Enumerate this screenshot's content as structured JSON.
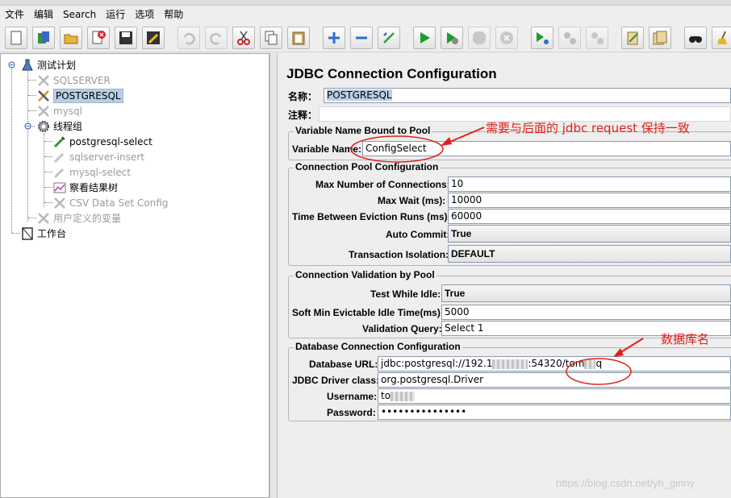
{
  "menu": [
    "文件",
    "编辑",
    "Search",
    "运行",
    "选项",
    "帮助"
  ],
  "toolbar": {
    "icons": [
      "new-icon",
      "templates-icon",
      "open-icon",
      "close-icon",
      "save-icon",
      "save-as-icon",
      "undo-icon",
      "redo-icon",
      "cut-icon",
      "copy-icon",
      "paste-icon",
      "expand-icon",
      "collapse-icon",
      "toggle-icon",
      "start-icon",
      "start-no-pauses-icon",
      "stop-icon",
      "shutdown-icon",
      "remote-start-icon",
      "remote-stop-icon",
      "remote-shutdown-icon",
      "clear-icon",
      "clear-all-icon",
      "search-icon",
      "reset-search-icon"
    ]
  },
  "tree": {
    "test_plan": "测试计划",
    "sqlserver": "SQLSERVER",
    "postgresql": "POSTGRESQL",
    "mysql": "mysql",
    "thread_group": "线程组",
    "postgresql_select": "postgresql-select",
    "sqlserver_insert": "sqlserver-insert",
    "mysql_select": "mysql-select",
    "result_tree": "察看结果树",
    "csv_config": "CSV Data Set Config",
    "user_vars": "用户定义的变量",
    "workbench": "工作台"
  },
  "config": {
    "title": "JDBC Connection Configuration",
    "name_label": "名称：",
    "name_value": "POSTGRESQL",
    "comment_label": "注释：",
    "comment_value": "",
    "pool_group": {
      "title": "Variable Name Bound to Pool",
      "variable_label": "Variable Name:",
      "variable_value": "ConfigSelect"
    },
    "connection_pool": {
      "title": "Connection Pool Configuration",
      "max_conn_label": "Max Number of Connections:",
      "max_conn_value": "10",
      "max_wait_label": "Max Wait (ms):",
      "max_wait_value": "10000",
      "eviction_label": "Time Between Eviction Runs (ms):",
      "eviction_value": "60000",
      "auto_commit_label": "Auto Commit:",
      "auto_commit_value": "True",
      "isolation_label": "Transaction Isolation:",
      "isolation_value": "DEFAULT"
    },
    "validation": {
      "title": "Connection Validation by Pool",
      "test_idle_label": "Test While Idle:",
      "test_idle_value": "True",
      "soft_min_label": "Soft Min Evictable Idle Time(ms):",
      "soft_min_value": "5000",
      "query_label": "Validation Query:",
      "query_value": "Select 1"
    },
    "database": {
      "title": "Database Connection Configuration",
      "url_label": "Database URL:",
      "url_prefix": "jdbc:postgresql://192.1",
      "url_middle": ":54320/tom",
      "url_suffix": "q",
      "driver_label": "JDBC Driver class:",
      "driver_value": "org.postgresql.Driver",
      "username_label": "Username:",
      "username_prefix": "to",
      "password_label": "Password:",
      "password_value": "•••••••••••••••"
    }
  },
  "annotations": {
    "pool_note": "需要与后面的 jdbc request 保持一致",
    "db_note": "数据库名",
    "color": "#e0201a"
  },
  "watermark": "https://blog.csdn.net/yh_ginny"
}
